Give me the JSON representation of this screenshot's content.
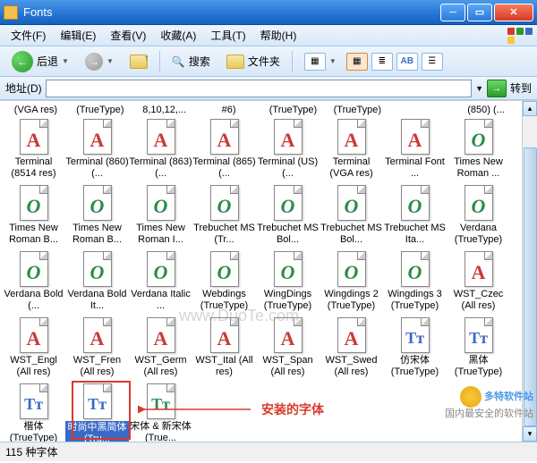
{
  "window": {
    "title": "Fonts"
  },
  "menu": {
    "file": "文件(F)",
    "edit": "编辑(E)",
    "view": "查看(V)",
    "favorites": "收藏(A)",
    "tools": "工具(T)",
    "help": "帮助(H)"
  },
  "toolbar": {
    "back": "后退",
    "search": "搜索",
    "folders": "文件夹"
  },
  "address": {
    "label": "地址(D)",
    "go": "转到",
    "value": ""
  },
  "toprow": [
    "(VGA res)",
    "(TrueType)",
    "8,10,12,...",
    "#6)",
    "(TrueType)",
    "(TrueType)",
    "",
    "(850) (..."
  ],
  "fonts": [
    {
      "g": "A",
      "name": "Terminal (8514 res)"
    },
    {
      "g": "A",
      "name": "Terminal (860) (..."
    },
    {
      "g": "A",
      "name": "Terminal (863) (..."
    },
    {
      "g": "A",
      "name": "Terminal (865) (..."
    },
    {
      "g": "A",
      "name": "Terminal (US) (..."
    },
    {
      "g": "A",
      "name": "Terminal (VGA res)"
    },
    {
      "g": "A",
      "name": "Terminal Font ..."
    },
    {
      "g": "O",
      "name": "Times New Roman ..."
    },
    {
      "g": "O",
      "name": "Times New Roman B..."
    },
    {
      "g": "O",
      "name": "Times New Roman B..."
    },
    {
      "g": "O",
      "name": "Times New Roman I..."
    },
    {
      "g": "O",
      "name": "Trebuchet MS (Tr..."
    },
    {
      "g": "O",
      "name": "Trebuchet MS Bol..."
    },
    {
      "g": "O",
      "name": "Trebuchet MS Bol..."
    },
    {
      "g": "O",
      "name": "Trebuchet MS Ita..."
    },
    {
      "g": "O",
      "name": "Verdana (TrueType)"
    },
    {
      "g": "O",
      "name": "Verdana Bold (..."
    },
    {
      "g": "O",
      "name": "Verdana Bold It..."
    },
    {
      "g": "O",
      "name": "Verdana Italic ..."
    },
    {
      "g": "O",
      "name": "Webdings (TrueType)"
    },
    {
      "g": "O",
      "name": "WingDings (TrueType)"
    },
    {
      "g": "O",
      "name": "Wingdings 2 (TrueType)"
    },
    {
      "g": "O",
      "name": "Wingdings 3 (TrueType)"
    },
    {
      "g": "A",
      "name": "WST_Czec (All res)"
    },
    {
      "g": "A",
      "name": "WST_Engl (All res)"
    },
    {
      "g": "A",
      "name": "WST_Fren (All res)"
    },
    {
      "g": "A",
      "name": "WST_Germ (All res)"
    },
    {
      "g": "A",
      "name": "WST_Ital (All res)"
    },
    {
      "g": "A",
      "name": "WST_Span (All res)"
    },
    {
      "g": "A",
      "name": "WST_Swed (All res)"
    },
    {
      "g": "TT",
      "name": "仿宋体 (TrueType)"
    },
    {
      "g": "TT",
      "name": "黑体 (TrueType)"
    },
    {
      "g": "TT",
      "name": "楷体 (TrueType)"
    },
    {
      "g": "TT",
      "name": "时尚中黑简体 (Tru...",
      "sel": true
    },
    {
      "g": "TTG",
      "name": "宋体 & 新宋体 (True..."
    }
  ],
  "annotation": "安装的字体",
  "status": "115 种字体",
  "watermark": "www.DuoTe.com",
  "brand": {
    "name": "多特软件站",
    "slogan": "国内最安全的软件站"
  }
}
